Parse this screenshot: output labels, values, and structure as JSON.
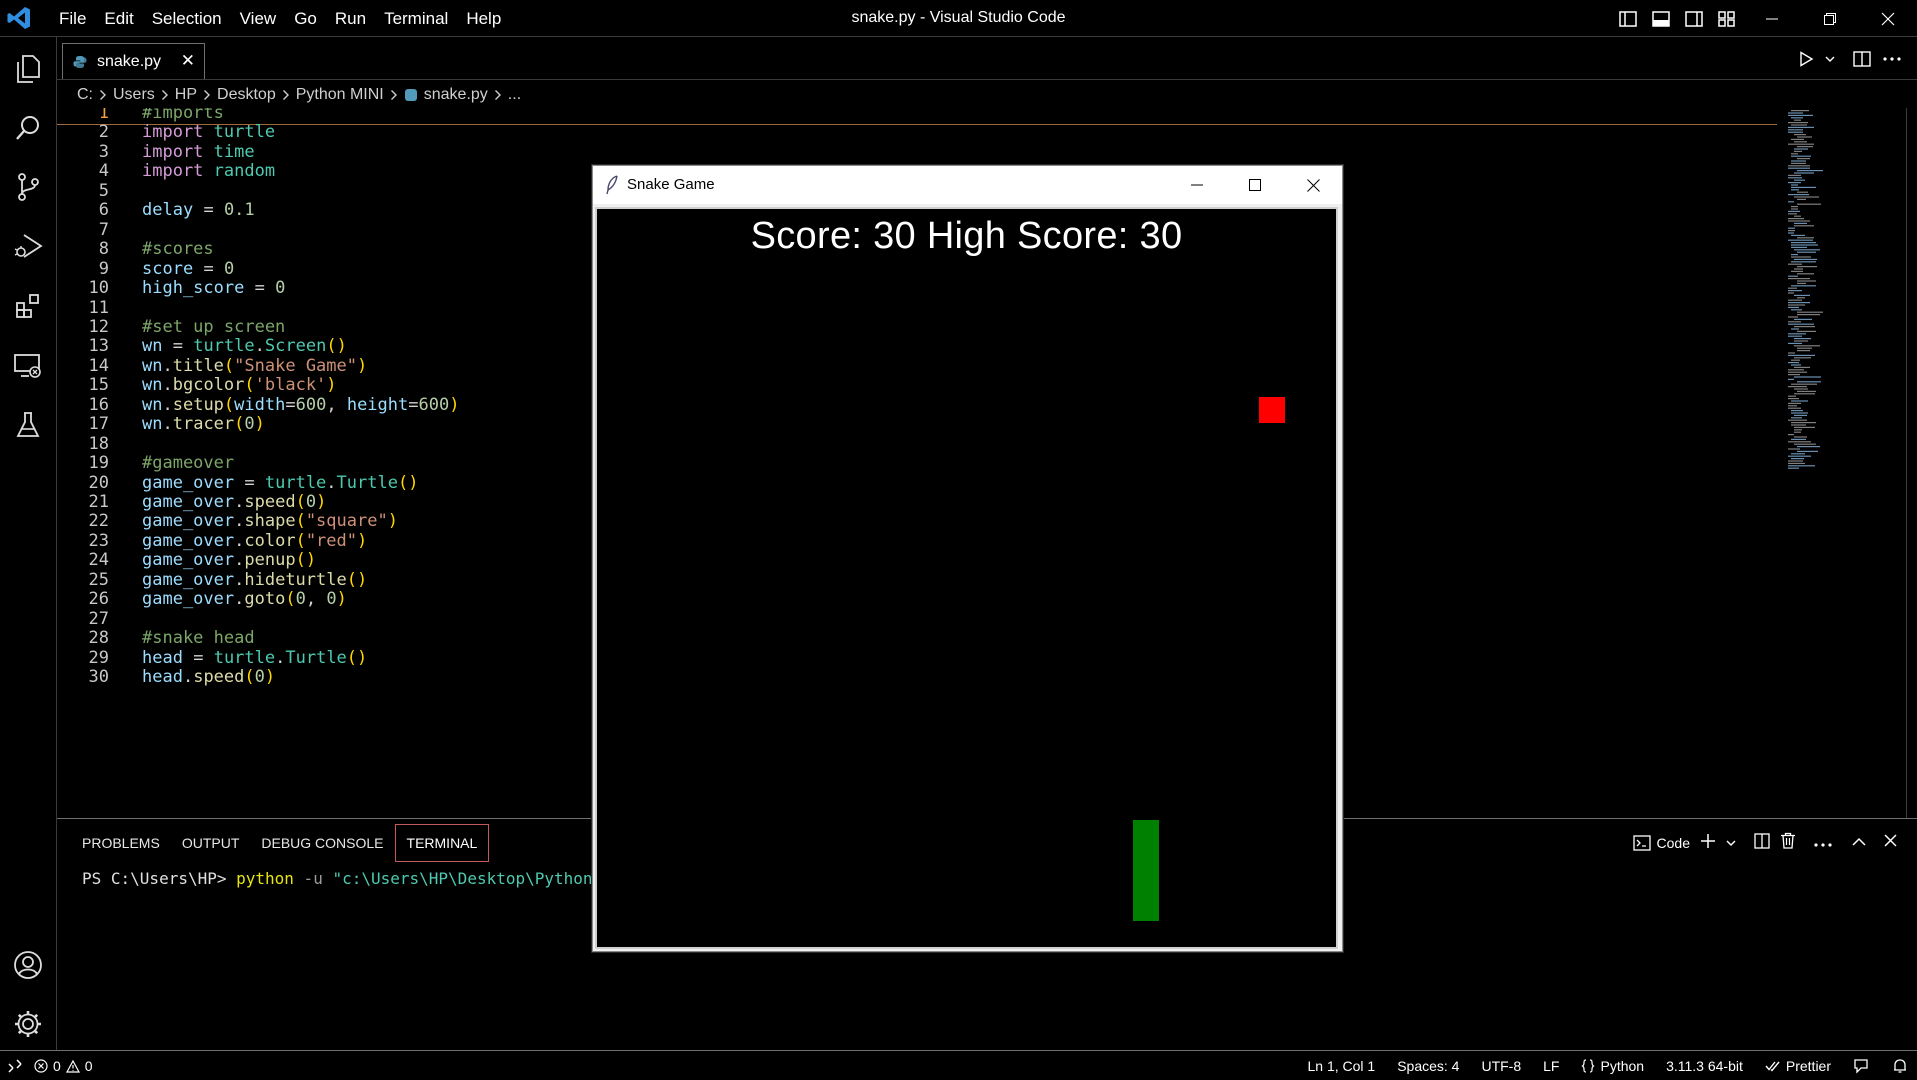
{
  "window_title": "snake.py - Visual Studio Code",
  "menu": [
    "File",
    "Edit",
    "Selection",
    "View",
    "Go",
    "Run",
    "Terminal",
    "Help"
  ],
  "tab": {
    "label": "snake.py",
    "close": "✕"
  },
  "breadcrumb": [
    "C:",
    "Users",
    "HP",
    "Desktop",
    "Python MINI",
    "snake.py",
    "..."
  ],
  "code": {
    "current_line": 1,
    "lines": [
      "#imports",
      "import turtle",
      "import time",
      "import random",
      "",
      "delay = 0.1",
      "",
      "#scores",
      "score = 0",
      "high_score = 0",
      "",
      "#set up screen",
      "wn = turtle.Screen()",
      "wn.title(\"Snake Game\")",
      "wn.bgcolor('black')",
      "wn.setup(width=600, height=600)",
      "wn.tracer(0)",
      "",
      "#gameover",
      "game_over = turtle.Turtle()",
      "game_over.speed(0)",
      "game_over.shape(\"square\")",
      "game_over.color(\"red\")",
      "game_over.penup()",
      "game_over.hideturtle()",
      "game_over.goto(0, 0)",
      "",
      "#snake head",
      "head = turtle.Turtle()",
      "head.speed(0)"
    ]
  },
  "panel": {
    "tabs": [
      "PROBLEMS",
      "OUTPUT",
      "DEBUG CONSOLE",
      "TERMINAL"
    ],
    "active_tab": "TERMINAL",
    "terminal_profile": "Code",
    "terminal": {
      "prompt": "PS C:\\Users\\HP> ",
      "command": "python",
      "flag": " -u ",
      "arg": "\"c:\\Users\\HP\\Desktop\\Python MIN"
    }
  },
  "statusbar": {
    "errors": "0",
    "warnings": "0",
    "position": "Ln 1, Col 1",
    "spaces": "Spaces: 4",
    "encoding": "UTF-8",
    "eol": "LF",
    "language": "Python",
    "interpreter": "3.11.3 64-bit",
    "formatter": "Prettier"
  },
  "snake_window": {
    "title": "Snake Game",
    "score_text": "Score: 30  High Score: 30",
    "background": "#000000",
    "food_color": "#ff0000",
    "snake_color": "#008000"
  },
  "icons": {
    "activity": [
      "explorer-icon",
      "search-icon",
      "source-control-icon",
      "run-debug-icon",
      "extensions-icon",
      "remote-explorer-icon",
      "testing-icon",
      "accounts-icon",
      "settings-gear-icon"
    ]
  },
  "colors": {
    "accent_current_line": "#a06a3c",
    "line_number_active": "#f4a340",
    "active_tab_border": "#c25a5a"
  }
}
